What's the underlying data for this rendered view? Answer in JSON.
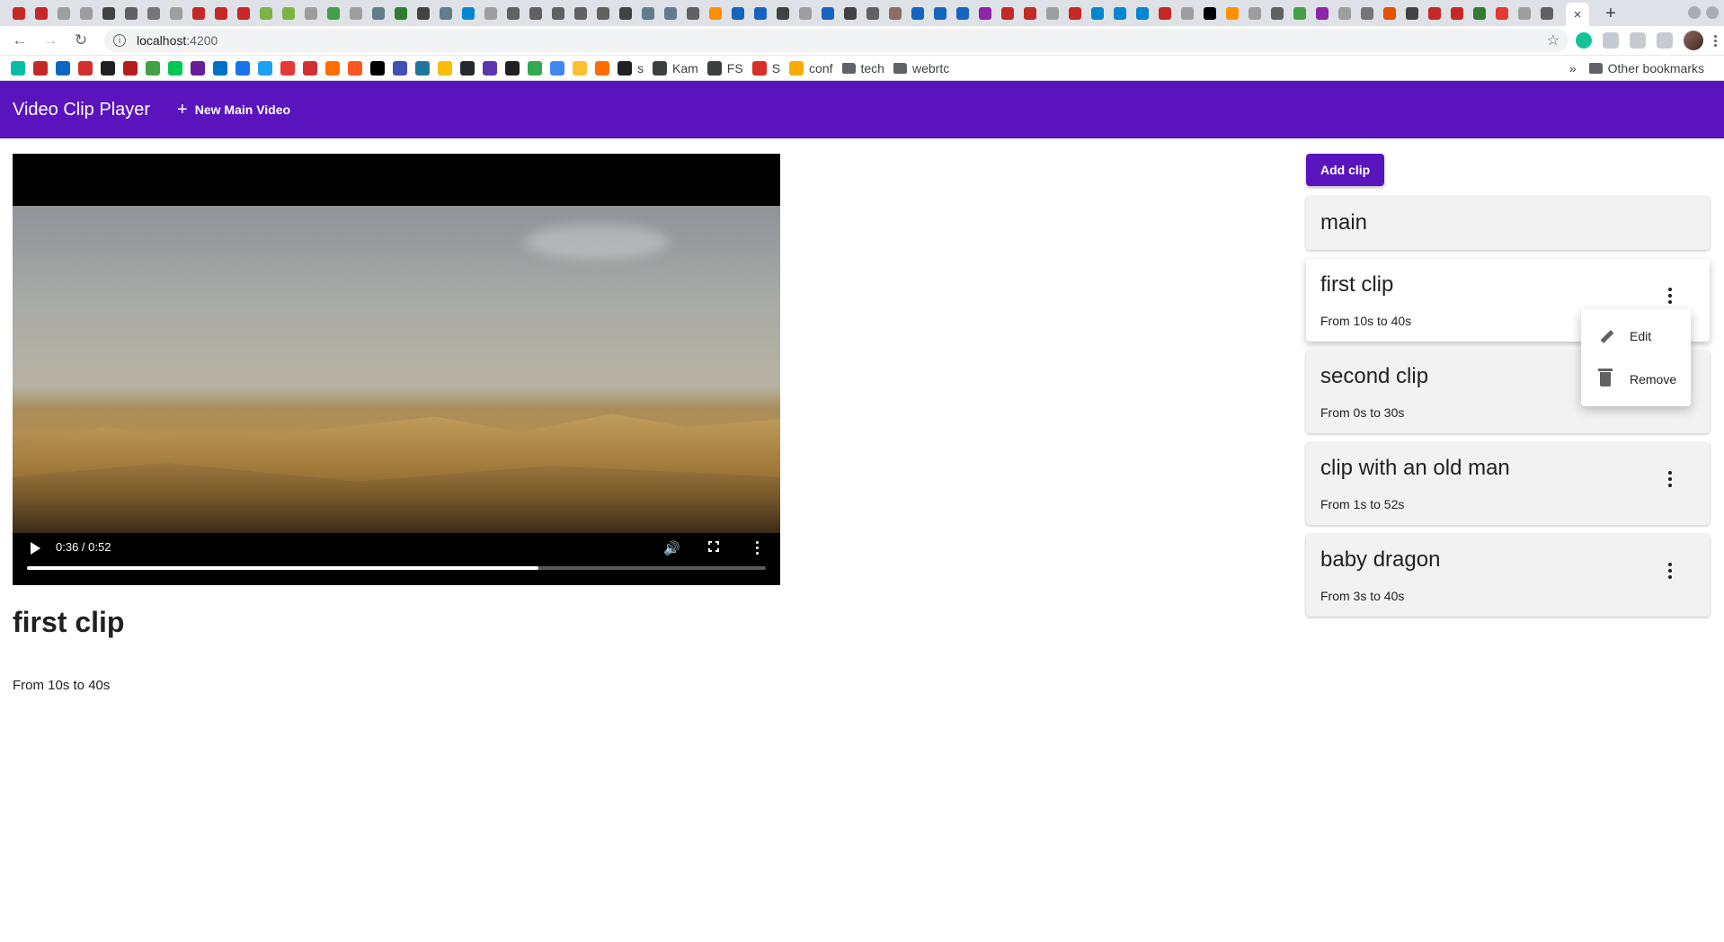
{
  "browser": {
    "active_tab_close": "×",
    "new_tab": "+",
    "url_host": "localhost",
    "url_port": ":4200",
    "bookmarks": [
      {
        "label": "s",
        "color": "#202124"
      },
      {
        "label": "Kam",
        "color": "#3c4043"
      },
      {
        "label": "FS",
        "color": "#3c4043"
      },
      {
        "label": "S",
        "color": "#d93025"
      },
      {
        "label": "conf",
        "color": "#f9ab00"
      },
      {
        "label": "tech",
        "color": "#5f6368"
      },
      {
        "label": "webrtc",
        "color": "#5f6368"
      }
    ],
    "bookmarks_overflow": "»",
    "other_bookmarks": "Other bookmarks"
  },
  "app": {
    "title": "Video Clip Player",
    "new_main_video": "New Main Video"
  },
  "player": {
    "time": "0:36 / 0:52",
    "progress": 0.692
  },
  "selected": {
    "name": "first clip",
    "range": "From 10s to 40s"
  },
  "sidebar": {
    "add_clip": "Add clip",
    "main_label": "main",
    "clips": [
      {
        "name": "first clip",
        "range": "From 10s to 40s"
      },
      {
        "name": "second clip",
        "range": "From 0s to 30s"
      },
      {
        "name": "clip with an old man",
        "range": "From 1s to 52s"
      },
      {
        "name": "baby dragon",
        "range": "From 3s to 40s"
      }
    ]
  },
  "menu": {
    "edit": "Edit",
    "remove": "Remove"
  }
}
